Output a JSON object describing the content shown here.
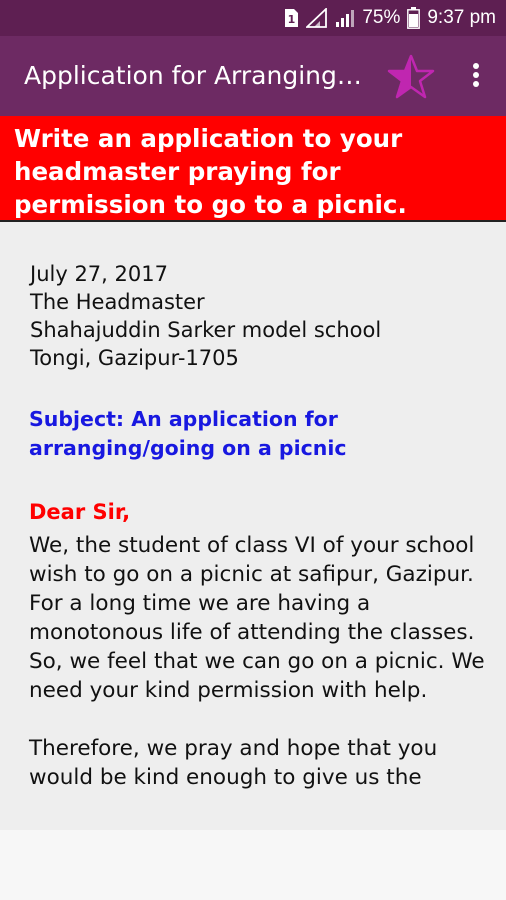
{
  "status_bar": {
    "sim_label": "1",
    "battery_percent": "75%",
    "time": "9:37 pm",
    "colors": {
      "background": "#5e1f52"
    },
    "icons": [
      "sim-icon",
      "signal-icon",
      "signal-icon",
      "battery-icon"
    ]
  },
  "app_bar": {
    "title": "Application for Arranging…",
    "icons": [
      "star-half-icon",
      "overflow-menu-icon"
    ],
    "colors": {
      "background": "#6d2a63",
      "star": "#c026b0"
    }
  },
  "banner": {
    "text": "Write an application to your headmaster praying for permission to go to a picnic.",
    "colors": {
      "background": "#ff0000",
      "text": "#ffffff"
    }
  },
  "letter": {
    "date": "July 27, 2017",
    "recipient": "The Headmaster",
    "school": "Shahajuddin Sarker model school",
    "address": "Tongi, Gazipur-1705",
    "subject": "Subject: An application for arranging/going on a picnic",
    "greeting": "Dear Sir,",
    "paragraphs": [
      "We, the student of class VI of your school wish to go on a picnic at safipur, Gazipur. For a long time we are having a monotonous life of attending the classes. So, we feel that we can go on a picnic. We need your kind permission with help.",
      "Therefore, we pray and hope that you would be kind enough to give us the"
    ],
    "colors": {
      "subject": "#1818e0",
      "greeting": "#ff0000"
    }
  }
}
